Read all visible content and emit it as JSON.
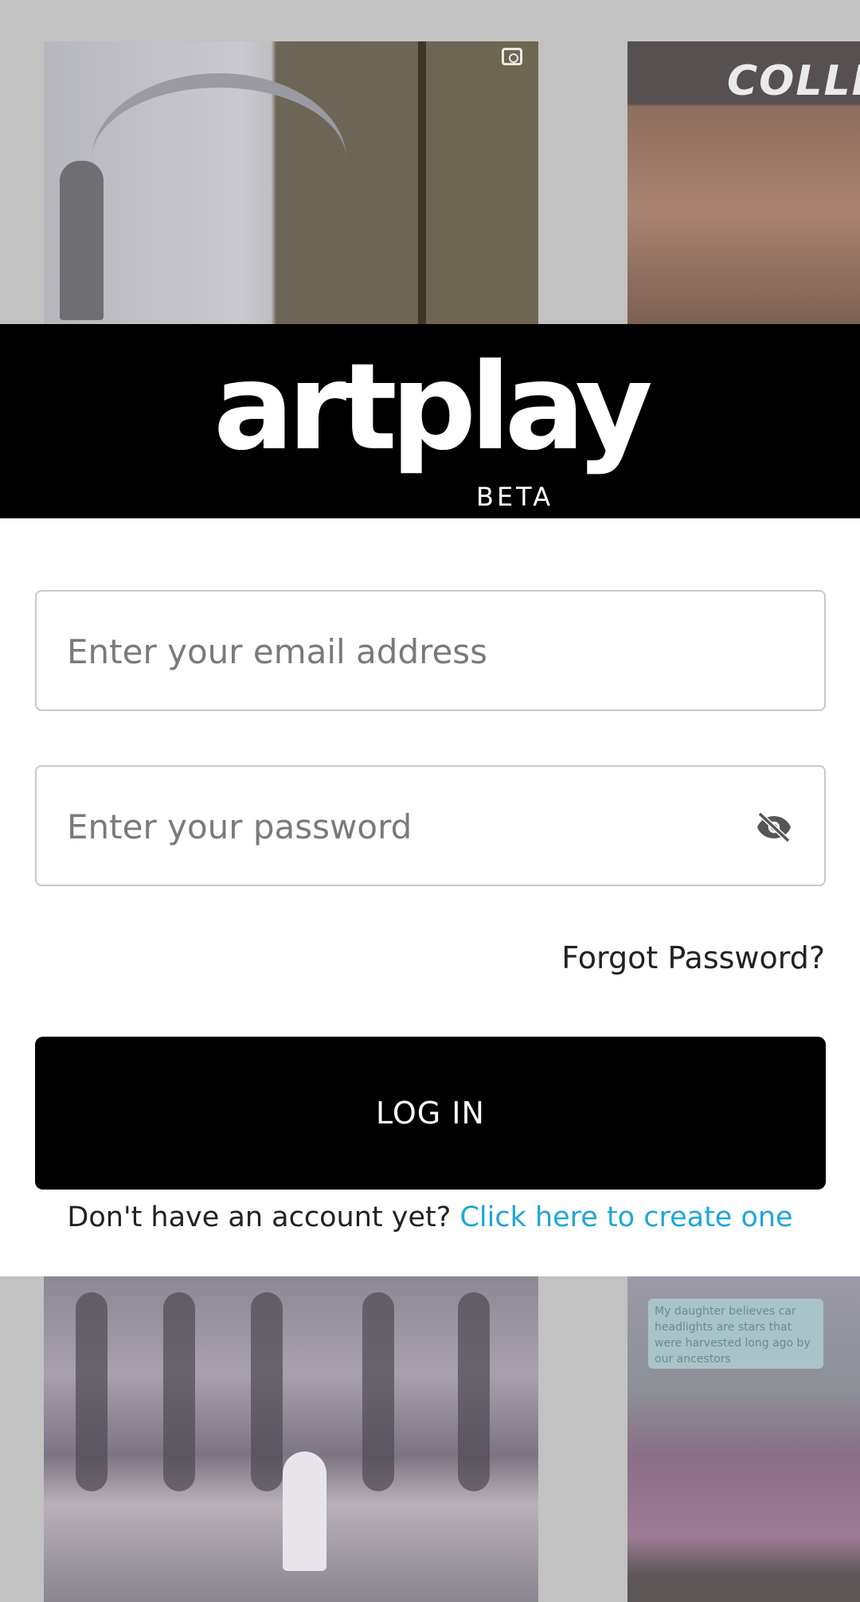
{
  "brand": {
    "logo_text": "artplay",
    "badge": "BETA"
  },
  "background_tiles": {
    "top_right_caption": "COLLE",
    "bottom_right_caption": "My daughter believes car headlights are stars that were harvested long ago by our ancestors"
  },
  "login_form": {
    "email_placeholder": "Enter your email address",
    "password_placeholder": "Enter your password",
    "password_toggle_icon": "eye-off-icon",
    "forgot_password": "Forgot Password?",
    "login_button": "LOG IN",
    "signup_prompt": "Don't have an account yet?",
    "signup_link": "Click here to create one"
  },
  "colors": {
    "banner_bg": "#000000",
    "button_bg": "#000000",
    "link": "#20a6d8",
    "overlay_bg": "#c2c2c2"
  }
}
